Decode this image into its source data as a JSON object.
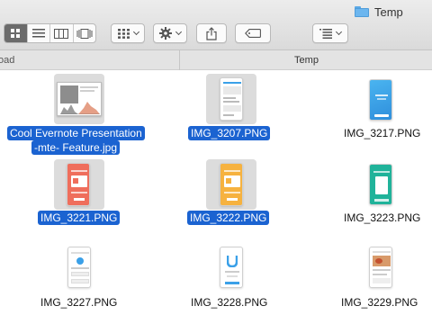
{
  "window": {
    "title": "Temp"
  },
  "pathbar": {
    "left": "oad",
    "right": "Temp"
  },
  "toolbar": {
    "view_icon": "icon-view-icon",
    "list_icon": "list-view-icon",
    "columns_icon": "column-view-icon",
    "gallery_icon": "cover-flow-icon",
    "group_icon": "group-by-icon",
    "action_icon": "gear-icon",
    "share_icon": "share-icon",
    "tag_icon": "tag-icon",
    "arrange_icon": "arrange-icon"
  },
  "files": [
    {
      "name": "Cool Evernote Presentation -mte- Feature.jpg",
      "line1": "Cool Evernote Presentation",
      "line2": "-mte- Feature.jpg",
      "selected": true
    },
    {
      "name": "IMG_3207.PNG",
      "selected": true
    },
    {
      "name": "IMG_3217.PNG",
      "selected": false
    },
    {
      "name": "IMG_3221.PNG",
      "selected": true
    },
    {
      "name": "IMG_3222.PNG",
      "selected": true
    },
    {
      "name": "IMG_3223.PNG",
      "selected": false
    },
    {
      "name": "IMG_3227.PNG",
      "selected": false
    },
    {
      "name": "IMG_3228.PNG",
      "selected": false
    },
    {
      "name": "IMG_3229.PNG",
      "selected": false
    }
  ],
  "colors": {
    "selection": "#1b63d1",
    "blue_app": "#3aa0e8",
    "coral_app": "#ef6e5c",
    "orange_app": "#f6b23f",
    "teal_app": "#20b39a"
  }
}
